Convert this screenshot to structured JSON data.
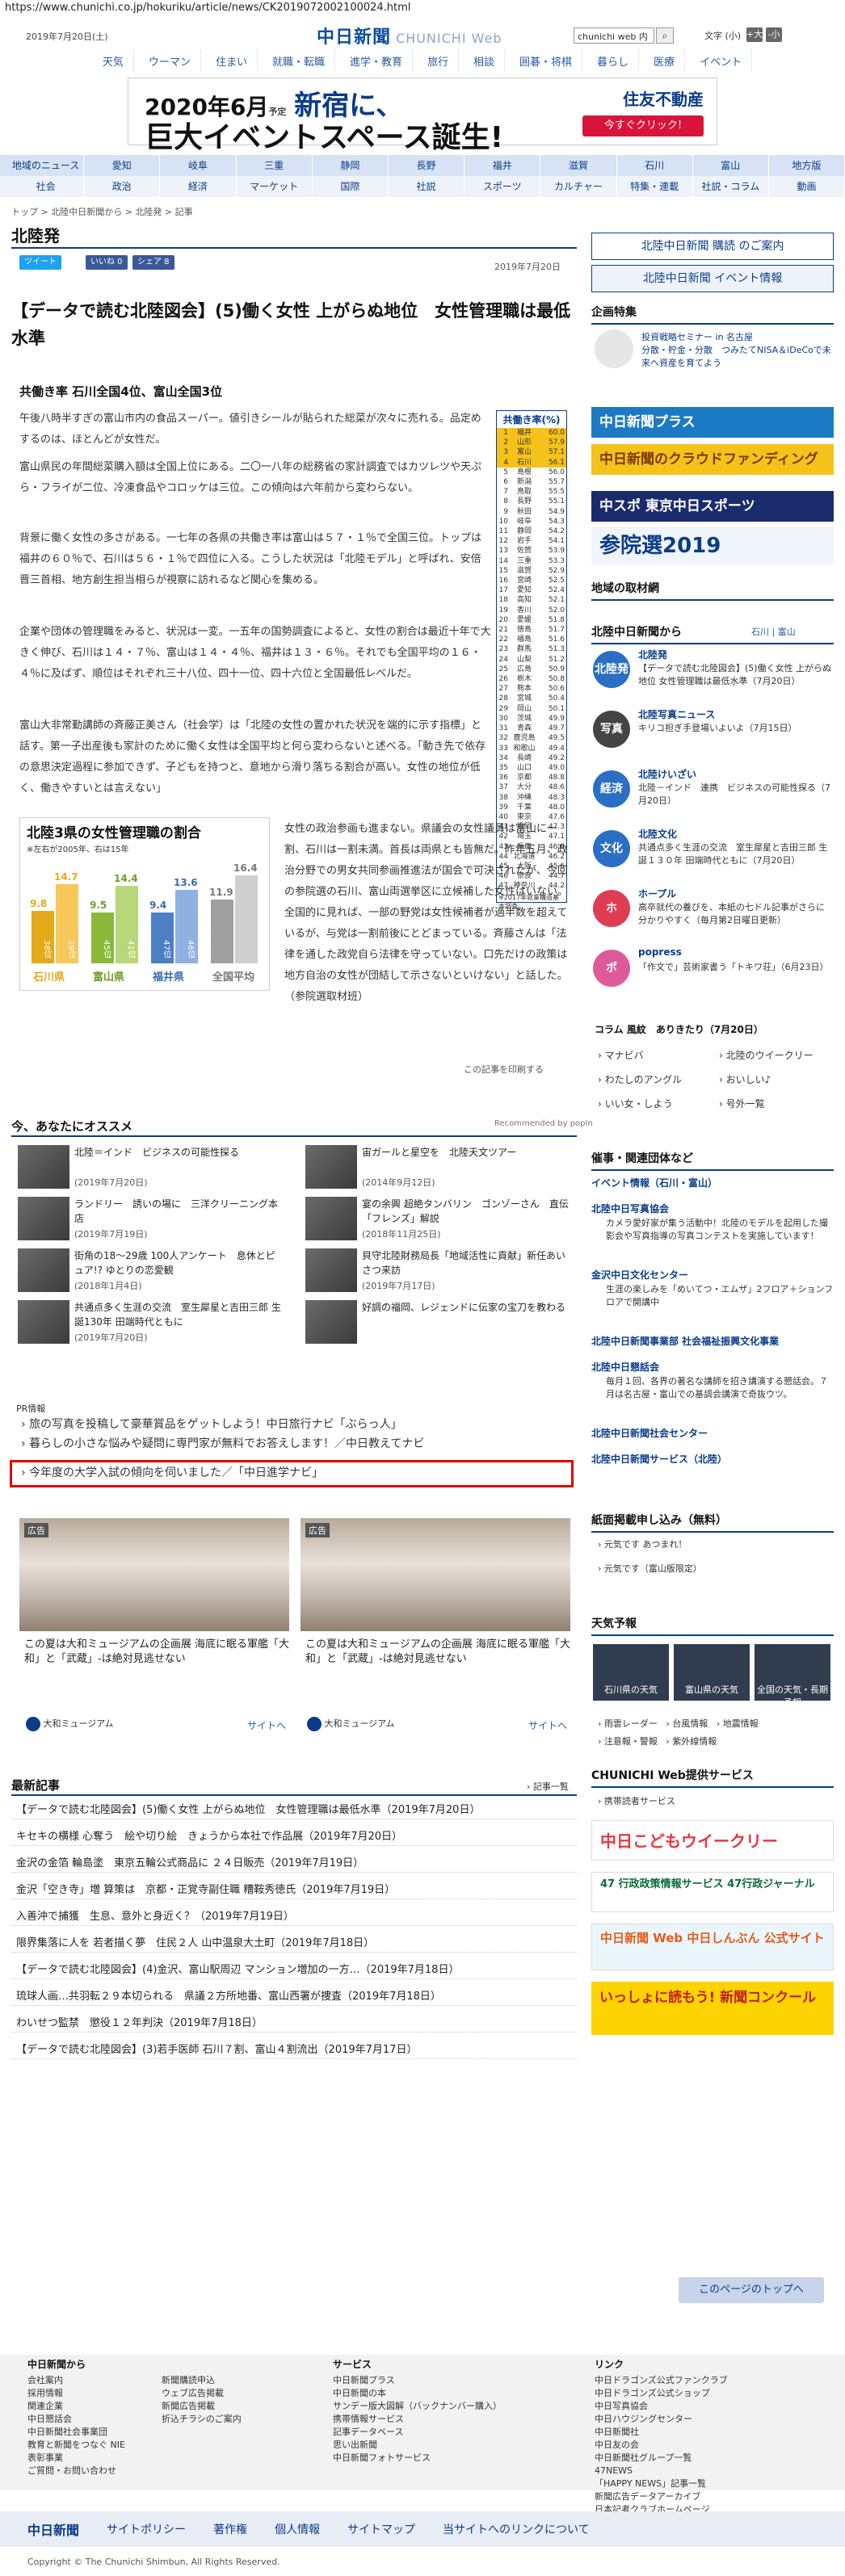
{
  "url": "https://www.chunichi.co.jp/hokuriku/article/news/CK2019072002100024.html",
  "header": {
    "date": "2019年7月20日(土)",
    "logo": "中日新聞",
    "logo_sub": "CHUNICHI Web",
    "search_value": "chunichi web 内",
    "font_label": "文字",
    "font_default": "(小)",
    "font_up": "+大",
    "font_down": "-小"
  },
  "global_nav": [
    "天気",
    "ウーマン",
    "住まい",
    "就職・転職",
    "進学・教育",
    "旅行",
    "相談",
    "囲碁・将棋",
    "暮らし",
    "医療",
    "イベント"
  ],
  "top_ad": {
    "line1_a": "2020年6月",
    "line1_b": "予定",
    "line1_c": "新宿に、",
    "line2": "巨大イベントスペース誕生!",
    "brand": "住友不動産",
    "cta": "今すぐクリック!"
  },
  "cat_nav_1": [
    "地域のニュース",
    "愛知",
    "岐阜",
    "三重",
    "静岡",
    "長野",
    "福井",
    "滋賀",
    "石川",
    "富山",
    "地方版"
  ],
  "cat_nav_2": [
    "社会",
    "政治",
    "経済",
    "マーケット",
    "国際",
    "社説",
    "スポーツ",
    "カルチャー",
    "特集・連載",
    "社説・コラム",
    "動画"
  ],
  "breadcrumb": "トップ > 北陸中日新聞から > 北陸発 > 記事",
  "section_title": "北陸発",
  "social": {
    "tweet": "ツイート",
    "like": "いいね 0",
    "share": "シェア 8"
  },
  "pub_date": "2019年7月20日",
  "article": {
    "title": "【データで読む北陸図会】(5)働く女性 上がらぬ地位　女性管理職は最低水準",
    "subhead": "共働き率 石川全国4位、富山全国3位",
    "p1": "午後八時半すぎの富山市内の食品スーパー。値引きシールが貼られた総菜が次々に売れる。品定めするのは、ほとんどが女性だ。",
    "p2": "富山県民の年間総菜購入額は全国上位にある。二〇一八年の総務省の家計調査ではカツレツや天ぷら・フライが二位、冷凍食品やコロッケは三位。この傾向は六年前から変わらない。",
    "p3": "背景に働く女性の多さがある。一七年の各県の共働き率は富山は５７・１％で全国三位。トップは福井の６０％で、石川は５６・１％で四位に入る。こうした状況は「北陸モデル」と呼ばれ、安倍晋三首相、地方創生担当相らが視察に訪れるなど関心を集める。",
    "p4": "企業や団体の管理職をみると、状況は一変。一五年の国勢調査によると、女性の割合は最近十年で大きく伸び、石川は１４・７％、富山は１４・４％、福井は１３・６％。それでも全国平均の１６・４％に及ばず、順位はそれぞれ三十八位、四十一位、四十六位と全国最低レベルだ。",
    "p5": "富山大非常勤講師の斉藤正美さん（社会学）は「北陸の女性の置かれた状況を端的に示す指標」と話す。第一子出産後も家計のために働く女性は全国平均と何ら変わらないと述べる。「動き先で依存の意思決定過程に参加できず、子どもを持つと、意地から滑り落ちる割合が高い。女性の地位が低く、働きやすいとは言えない」",
    "p6": "女性の政治参画も進まない。県議会の女性議員は富山に一割、石川は一割未満。首長は両県とも皆無だ。昨年五月、政治分野での男女共同参画推進法が国会で可決されたが、今回の参院選の石川、富山両選挙区に立候補した女性はいない。全国的に見れば、一部の野党は女性候補者が過半数を超えているが、与党は一割前後にとどまっている。斉藤さんは「法律を通した政党自ら法律を守っていない。口先だけの政策は地方自治の女性が団結して示さないといけない」と話した。（参院選取材班）",
    "print_link": "この記事を印刷する"
  },
  "side_table": {
    "title": "共働き率(%)",
    "rows": [
      [
        "1",
        "福井",
        "60.0"
      ],
      [
        "2",
        "山形",
        "57.9"
      ],
      [
        "3",
        "富山",
        "57.1"
      ],
      [
        "4",
        "石川",
        "56.1"
      ],
      [
        "5",
        "島根",
        "56.0"
      ],
      [
        "6",
        "新潟",
        "55.7"
      ],
      [
        "7",
        "鳥取",
        "55.5"
      ],
      [
        "8",
        "長野",
        "55.1"
      ],
      [
        "9",
        "秋田",
        "54.9"
      ],
      [
        "10",
        "岐阜",
        "54.3"
      ],
      [
        "11",
        "静岡",
        "54.2"
      ],
      [
        "12",
        "岩手",
        "54.1"
      ],
      [
        "13",
        "佐賀",
        "53.9"
      ],
      [
        "14",
        "三重",
        "53.3"
      ],
      [
        "15",
        "滋賀",
        "52.9"
      ],
      [
        "16",
        "宮崎",
        "52.5"
      ],
      [
        "17",
        "愛知",
        "52.4"
      ],
      [
        "18",
        "高知",
        "52.1"
      ],
      [
        "19",
        "香川",
        "52.0"
      ],
      [
        "20",
        "愛媛",
        "51.8"
      ],
      [
        "21",
        "徳島",
        "51.7"
      ],
      [
        "22",
        "福島",
        "51.6"
      ],
      [
        "23",
        "群馬",
        "51.3"
      ],
      [
        "24",
        "山梨",
        "51.2"
      ],
      [
        "25",
        "広島",
        "50.9"
      ],
      [
        "26",
        "栃木",
        "50.8"
      ],
      [
        "27",
        "熊本",
        "50.6"
      ],
      [
        "28",
        "宮城",
        "50.4"
      ],
      [
        "29",
        "岡山",
        "50.1"
      ],
      [
        "30",
        "茨城",
        "49.9"
      ],
      [
        "31",
        "青森",
        "49.7"
      ],
      [
        "32",
        "鹿児島",
        "49.5"
      ],
      [
        "33",
        "和歌山",
        "49.4"
      ],
      [
        "34",
        "長崎",
        "49.2"
      ],
      [
        "35",
        "山口",
        "49.0"
      ],
      [
        "36",
        "京都",
        "48.8"
      ],
      [
        "37",
        "大分",
        "48.6"
      ],
      [
        "38",
        "沖縄",
        "48.3"
      ],
      [
        "39",
        "千葉",
        "48.0"
      ],
      [
        "40",
        "東京",
        "47.6"
      ],
      [
        "41",
        "福岡",
        "47.3"
      ],
      [
        "42",
        "埼玉",
        "47.1"
      ],
      [
        "43",
        "兵庫",
        "46.6"
      ],
      [
        "44",
        "北海道",
        "46.2"
      ],
      [
        "45",
        "大阪",
        "45.6"
      ],
      [
        "46",
        "奈良",
        "44.7"
      ],
      [
        "47",
        "神奈川",
        "44.2"
      ]
    ],
    "note": "※2017年就業構造基本調査"
  },
  "chart_data": {
    "type": "bar",
    "title": "北陸3県の女性管理職の割合",
    "subtitle": "※左右が2005年、右は15年",
    "categories": [
      "石川県",
      "富山県",
      "福井県",
      "全国平均"
    ],
    "series": [
      {
        "name": "2005年",
        "values": [
          9.8,
          9.5,
          9.4,
          11.9
        ]
      },
      {
        "name": "15年",
        "values": [
          14.7,
          14.4,
          13.6,
          16.4
        ]
      }
    ],
    "rank_2005": [
      "38位",
      "45位",
      "47位",
      ""
    ],
    "rank_2015": [
      "39位",
      "41位",
      "46位",
      ""
    ],
    "ylim": [
      0,
      18
    ]
  },
  "recommend": {
    "title": "今、あなたにオススメ",
    "by": "Recommended by popIn",
    "items": [
      {
        "text": "北陸＝インド　ビジネスの可能性探る",
        "date": "(2019年7月20日)"
      },
      {
        "text": "宙ガールと星空を　北陸天文ツアー",
        "date": "(2014年9月12日)"
      },
      {
        "text": "ランドリー　誘いの場に　三洋クリーニング本店",
        "date": "(2019年7月19日)"
      },
      {
        "text": "宴の余興 超絶タンバリン　ゴンゾーさん　直伝「フレンズ」解説",
        "date": "(2018年11月25日)"
      },
      {
        "text": "街角の18〜29歳 100人アンケート　息休とピュア!? ゆとりの恋愛観",
        "date": "(2018年1月4日)"
      },
      {
        "text": "貝守北陸財務局長「地域活性に貢献」新任あいさつ来訪",
        "date": "(2019年7月17日)"
      },
      {
        "text": "共通点多く生涯の交流　室生犀星と吉田三郎 生誕130年 田端時代ともに",
        "date": "(2019年7月20日)"
      },
      {
        "text": "好調の福岡、レジェンドに伝家の宝刀を教わる",
        "date": ""
      }
    ]
  },
  "pr": {
    "label": "PR情報",
    "links": [
      "旅の写真を投稿して豪華賞品をゲットしよう！中日旅行ナビ「ぶらっ人」",
      "暮らしの小さな悩みや疑問に専門家が無料でお答えします！／中日教えてナビ",
      "今年度の大学入試の傾向を伺いました／「中日進学ナビ」"
    ]
  },
  "ads": [
    {
      "label": "広告",
      "caption": "この夏は大和ミュージアムの企画展 海底に眠る軍艦「大和」と「武蔵」-は絶対見逃せない",
      "sponsor": "大和ミュージアム",
      "link": "サイトへ"
    },
    {
      "label": "広告",
      "caption": "この夏は大和ミュージアムの企画展 海底に眠る軍艦「大和」と「武蔵」-は絶対見逃せない",
      "sponsor": "大和ミュージアム",
      "link": "サイトへ"
    }
  ],
  "recent": {
    "title": "最新記事",
    "more": "記事一覧",
    "items": [
      "【データで読む北陸図会】(5)働く女性 上がらぬ地位　女性管理職は最低水準（2019年7月20日）",
      "キセキの横様 心奪う　絵や切り絵　きょうから本社で作品展（2019年7月20日）",
      "金沢の金箔 輪島塗　東京五輪公式商品に ２４日販売（2019年7月19日）",
      "金沢「空き寺」増 算策は　京都・正覚寺副住職 糟鞍秀徳氏（2019年7月19日）",
      "入善沖で捕獲　生息、意外と身近く？（2019年7月19日）",
      "限界集落に人を 若者描く夢　住民２人 山中温泉大土町（2019年7月18日）",
      "【データで読む北陸図会】(4)金沢、富山駅周辺 マンション増加の一方…（2019年7月18日）",
      "琉球人画…共羽転２９本切られる　県議２方所地番、富山西署が捜査（2019年7月18日）",
      "わいせつ監禁　懲役１２年判決（2019年7月18日）",
      "【データで読む北陸図会】(3)若手医師 石川７割、富山４割流出（2019年7月17日）"
    ]
  },
  "sidebar": {
    "subscribe": "北陸中日新聞 購読 のご案内",
    "events": "北陸中日新聞 イベント情報",
    "special_title": "企画特集",
    "special_item": "投資戦略セミナー in 名古屋\n分散・貯金・分散　つみたてNISA＆iDeCoで未来へ資産を育てよう",
    "banners": [
      "中日新聞プラス",
      "中日新聞のクラウドファンディング",
      "中スポ 東京中日スポーツ",
      "参院選2019"
    ],
    "local_title": "地域の取材網",
    "from_title": "北陸中日新聞から",
    "from_links": "石川 | 富山",
    "from_items": [
      {
        "icon": "北陸発",
        "title": "北陸発",
        "desc": "【データで読む北陸図会】(5)働く女性 上がらぬ地位 女性管理職は最低水準（7月20日）"
      },
      {
        "icon": "写真",
        "title": "北陸写真ニュース",
        "desc": "キリコ担ぎ手登場いよいよ（7月15日）"
      },
      {
        "icon": "経済",
        "title": "北陸けいざい",
        "desc": "北陸－インド　連携　ビジネスの可能性探る（7月20日）"
      },
      {
        "icon": "文化",
        "title": "北陸文化",
        "desc": "共通点多く生涯の交流　室生犀星と吉田三郎 生誕１３０年 田端時代ともに（7月20日）"
      },
      {
        "icon": "ホ",
        "title": "ホープル",
        "desc": "高卒就代の養びを、本紙の七ドル記事がさらに分かりやすく（毎月第2日曜日更新）"
      },
      {
        "icon": "ポ",
        "title": "popress",
        "desc": "「作文で」芸術家書う「トキワ荘」（6月23日）"
      }
    ],
    "column": "コラム 風紋　ありきたり（7月20日）",
    "column_links": [
      "マナビバ",
      "北陸のウイークリー",
      "わたしのアングル",
      "おいしい♪",
      "いい女・しよう",
      "号外一覧"
    ],
    "orgs_title": "催事・関連団体など",
    "orgs": [
      {
        "title": "イベント情報（石川・富山）",
        "desc": ""
      },
      {
        "title": "北陸中日写真協会",
        "desc": "カメラ愛好家が集う活動中！北陸のモデルを起用した撮影会や写真指導の写真コンテストを実施しています！"
      },
      {
        "title": "金沢中日文化センター",
        "desc": "生涯の楽しみを「めいてつ・エムザ」2フロア＋ションフロアで開講中"
      },
      {
        "title": "北陸中日新聞事業部 社会福祉振興文化事業",
        "desc": ""
      },
      {
        "title": "北陸中日懇話会",
        "desc": "毎月１回、各界の著名な講師を招き講演する懇話会。７月は名古屋・富山での基調会講演で奇抜ウツ。"
      },
      {
        "title": "北陸中日新聞社会センター",
        "desc": ""
      },
      {
        "title": "北陸中日新聞サービス（北陸）",
        "desc": ""
      }
    ],
    "paper_title": "紙面掲載申し込み（無料）",
    "paper_links": [
      "元気です あつまれ！",
      "元気です（富山版限定）"
    ],
    "weather_title": "天気予報",
    "weather": [
      "石川県の天気",
      "富山県の天気",
      "全国の天気・長期予報"
    ],
    "weather_links": [
      "雨雲レーダー",
      "台風情報",
      "地震情報",
      "注意報・警報",
      "紫外線情報"
    ],
    "service_title": "CHUNICHI Web提供サービス",
    "service_link": "携帯読者サービス",
    "promo": [
      "中日こどもウイークリー",
      "47 行政政策情報サービス 47行政ジャーナル",
      "中日新聞 Web 中日しんぶん 公式サイト",
      "いっしょに読もう! 新聞コンクール"
    ]
  },
  "totop": "このページのトップへ",
  "footer": {
    "cols": [
      {
        "head": "中日新聞から",
        "items": [
          "会社案内",
          "採用情報",
          "関連企業",
          "中日懇話会",
          "中日新聞社会事業団",
          "教育と新聞をつなぐ NIE",
          "表彰事業",
          "ご質問・お問い合わせ"
        ]
      },
      {
        "head": "",
        "items": [
          "新聞購読申込",
          "ウェブ広告掲載",
          "新聞広告掲載",
          "折込チラシのご案内"
        ]
      },
      {
        "head": "サービス",
        "items": [
          "中日新聞プラス",
          "中日新聞の本",
          "サンデー版大図解（バックナンバー購入）",
          "携帯情報サービス",
          "記事データベース",
          "思い出新聞",
          "中日新聞フォトサービス"
        ]
      },
      {
        "head": "リンク",
        "items": [
          "中日ドラゴンズ公式ファンクラブ",
          "中日ドラゴンズ公式ショップ",
          "中日写真協会",
          "中日ハウジングセンター",
          "中日新聞社",
          "中日友の会",
          "中日新聞社グループ一覧",
          "47NEWS",
          "「HAPPY NEWS」記事一覧",
          "新聞広告データアーカイブ",
          "日本記者クラブホームページ"
        ]
      }
    ],
    "bar": [
      "中日新聞",
      "サイトポリシー",
      "著作権",
      "個人情報",
      "サイトマップ",
      "当サイトへのリンクについて"
    ],
    "copyright": "Copyright © The Chunichi Shimbun, All Rights Reserved."
  }
}
